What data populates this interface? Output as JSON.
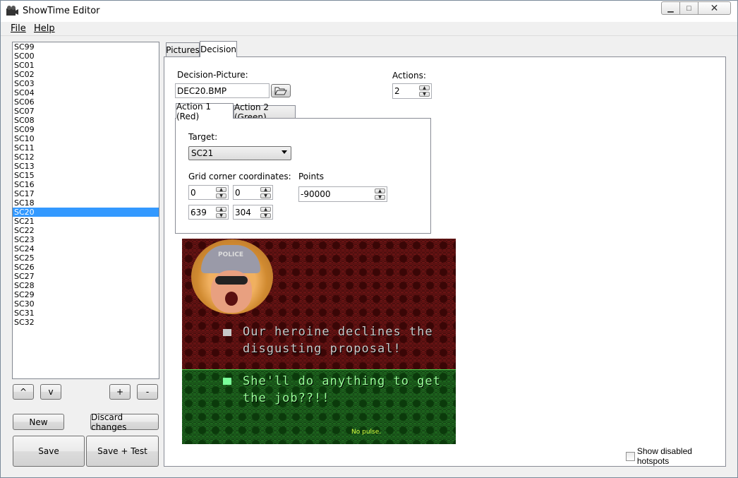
{
  "window": {
    "title": "ShowTime Editor",
    "min_glyph": "▁",
    "max_glyph": "□",
    "close_glyph": "✕"
  },
  "menu": {
    "file_label": "File",
    "help_label": "Help"
  },
  "scenes": {
    "items": [
      "SC99",
      "SC00",
      "SC01",
      "SC02",
      "SC03",
      "SC04",
      "SC06",
      "SC07",
      "SC08",
      "SC09",
      "SC10",
      "SC11",
      "SC12",
      "SC13",
      "SC15",
      "SC16",
      "SC17",
      "SC18",
      "SC20",
      "SC21",
      "SC22",
      "SC23",
      "SC24",
      "SC25",
      "SC26",
      "SC27",
      "SC28",
      "SC29",
      "SC30",
      "SC31",
      "SC32"
    ],
    "selected": "SC20"
  },
  "list_buttons": {
    "up": "^",
    "down": "v",
    "add": "+",
    "remove": "-"
  },
  "actions_buttons": {
    "new": "New",
    "discard": "Discard changes",
    "save": "Save",
    "save_test": "Save + Test"
  },
  "tabs": {
    "pictures": "Pictures",
    "decision": "Decision"
  },
  "decision": {
    "picture_label": "Decision-Picture:",
    "picture_value": "DEC20.BMP",
    "actions_label": "Actions:",
    "actions_value": "2"
  },
  "action_tabs": {
    "action1": "Action 1 (Red)",
    "action2": "Action 2 (Green)"
  },
  "action": {
    "target_label": "Target:",
    "target_value": "SC21",
    "grid_label": "Grid corner coordinates:",
    "grid_x1": "0",
    "grid_y1": "0",
    "grid_x2": "639",
    "grid_y2": "304",
    "points_label": "Points",
    "points_value": "-90000"
  },
  "preview": {
    "helmet_text": "POLICE",
    "option1_line1": "Our heroine declines the",
    "option1_line2": "disgusting proposal!",
    "option2_line1": "She'll do anything to get",
    "option2_line2": "the job??!!",
    "footer_text": "No pulse."
  },
  "show_disabled_label": "Show disabled hotspots",
  "colors": {
    "selection": "#3399ff",
    "red_region": "#6e1414",
    "green_region": "#1f6a1f"
  }
}
